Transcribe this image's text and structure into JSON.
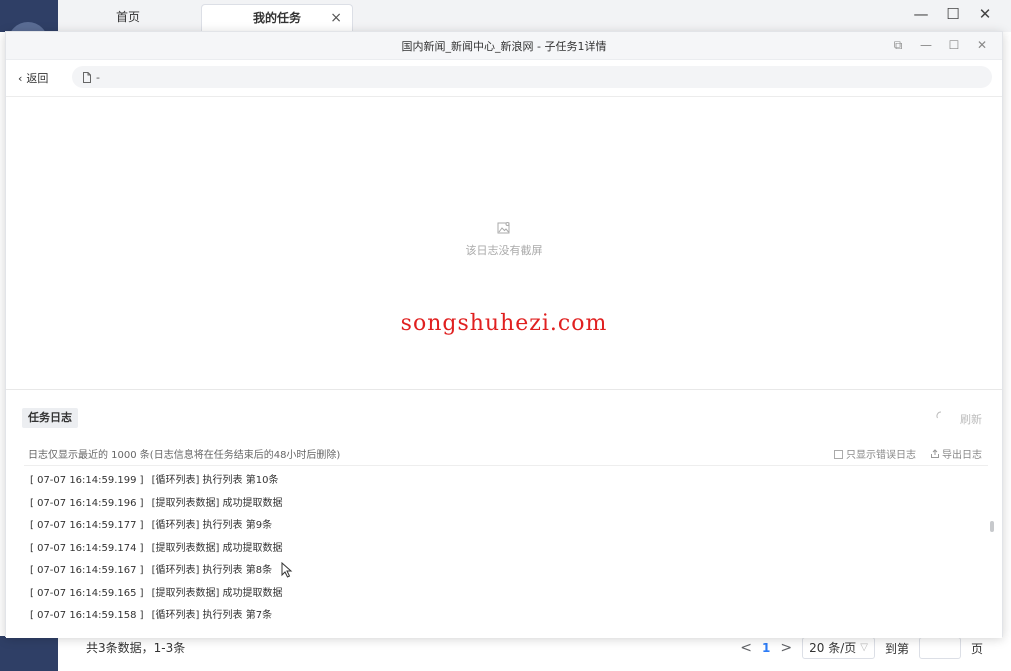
{
  "app": {
    "tabs": [
      {
        "label": "首页"
      },
      {
        "label": "我的任务"
      }
    ],
    "tab_close_glyph": "×",
    "window_controls": [
      "—",
      "☐",
      "✕"
    ]
  },
  "dialog": {
    "title": "国内新闻_新闻中心_新浪网 - 子任务1详情",
    "controls": [
      "⧉",
      "—",
      "☐",
      "✕"
    ],
    "back_label": "返回",
    "back_glyph": "‹",
    "address_text": "-",
    "screenshot": {
      "empty_text": "该日志没有截屏"
    },
    "watermark": "songshuhezi.com"
  },
  "log": {
    "tab_label": "任务日志",
    "refresh_label": "刷新",
    "note": "日志仅显示最近的 1000 条(日志信息将在任务结束后的48小时后删除)",
    "only_errors_label": "只显示错误日志",
    "export_label": "导出日志",
    "entries": [
      {
        "ts": "[ 07-07 16:14:59.199 ]",
        "msg": "[循环列表] 执行列表 第10条"
      },
      {
        "ts": "[ 07-07 16:14:59.196 ]",
        "msg": "[提取列表数据] 成功提取数据"
      },
      {
        "ts": "[ 07-07 16:14:59.177 ]",
        "msg": "[循环列表] 执行列表 第9条"
      },
      {
        "ts": "[ 07-07 16:14:59.174 ]",
        "msg": "[提取列表数据] 成功提取数据"
      },
      {
        "ts": "[ 07-07 16:14:59.167 ]",
        "msg": "[循环列表] 执行列表 第8条"
      },
      {
        "ts": "[ 07-07 16:14:59.165 ]",
        "msg": "[提取列表数据] 成功提取数据"
      },
      {
        "ts": "[ 07-07 16:14:59.158 ]",
        "msg": "[循环列表] 执行列表 第7条"
      }
    ]
  },
  "footer": {
    "total_text": "共3条数据，1-3条",
    "prev_glyph": "<",
    "next_glyph": ">",
    "current_page": "1",
    "page_size": "20 条/页",
    "goto_label": "到第",
    "page_suffix": "页"
  },
  "colors": {
    "accent": "#2d7cf6",
    "watermark": "#e02020",
    "sidebar": "#2f3f66"
  }
}
